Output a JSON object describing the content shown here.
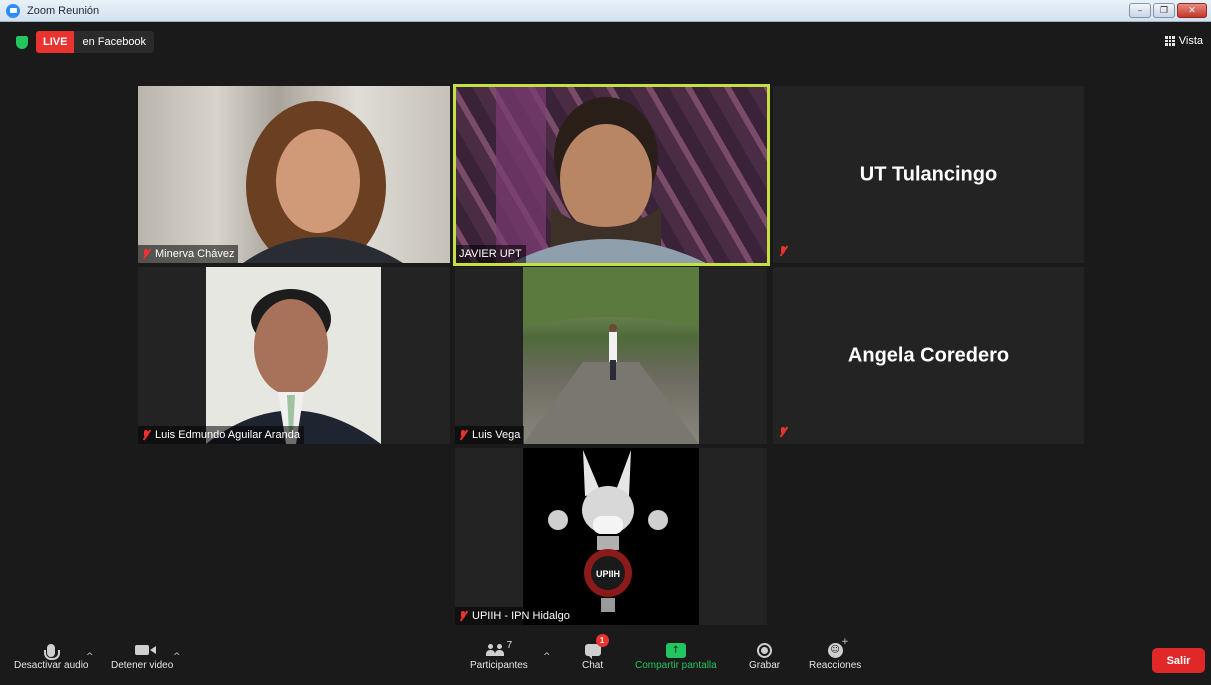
{
  "window": {
    "title": "Zoom Reunión",
    "minimize": "–",
    "maximize": "❐",
    "close": "✕"
  },
  "live": {
    "badge": "LIVE",
    "destination": "en Facebook"
  },
  "view": {
    "label": "Vista"
  },
  "participants": [
    {
      "name": "Minerva Chávez",
      "video": true,
      "muted": true
    },
    {
      "name": "JAVIER UPT",
      "video": true,
      "muted": false,
      "active_speaker": true
    },
    {
      "name": "UT Tulancingo",
      "video": false,
      "muted": true
    },
    {
      "name": "Luis Edmundo Aguilar Aranda",
      "video": true,
      "muted": true
    },
    {
      "name": "Luis Vega",
      "video": true,
      "muted": true
    },
    {
      "name": "Angela Coredero",
      "video": false,
      "muted": true
    },
    {
      "name": "UPIIH - IPN Hidalgo",
      "video": true,
      "muted": true,
      "logo_text": "UPIIH"
    }
  ],
  "toolbar": {
    "audio_label": "Desactivar audio",
    "video_label": "Detener video",
    "participants_label": "Participantes",
    "participants_count": "7",
    "chat_label": "Chat",
    "chat_badge": "1",
    "share_label": "Compartir pantalla",
    "record_label": "Grabar",
    "reactions_label": "Reacciones",
    "leave_label": "Salir",
    "caret": "^"
  },
  "colors": {
    "live": "#e8332e",
    "active_speaker": "#c4e042",
    "share": "#22c55e",
    "leave": "#e02828"
  }
}
